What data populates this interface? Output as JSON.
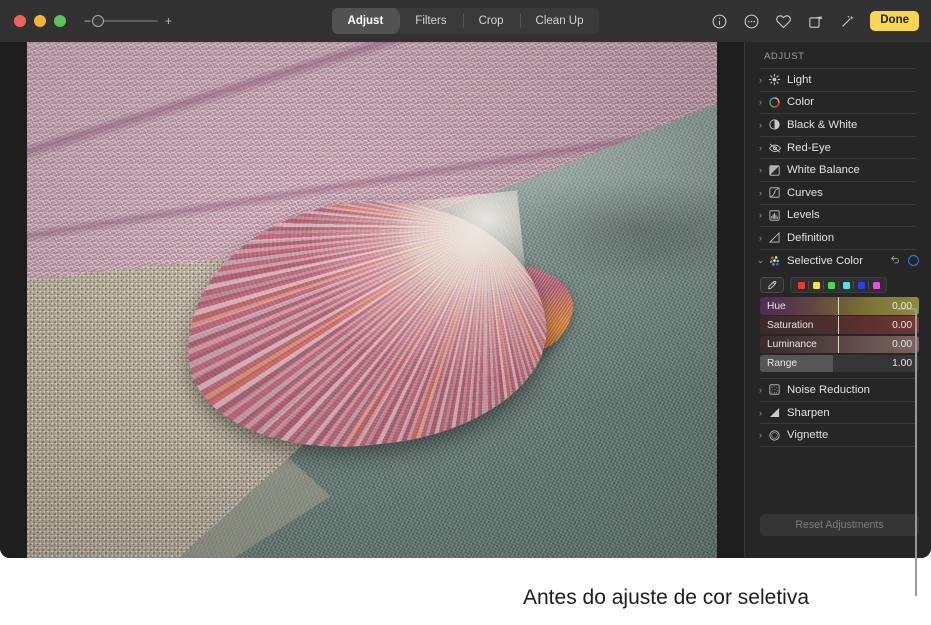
{
  "window": {
    "traffic_lights": [
      {
        "name": "close",
        "color": "#f2635a"
      },
      {
        "name": "minimize",
        "color": "#f5b53a"
      },
      {
        "name": "zoom",
        "color": "#5cc45a"
      }
    ]
  },
  "toolbar": {
    "zoom": {
      "minus": "−",
      "plus": "+",
      "level": 0
    },
    "tabs": [
      {
        "label": "Adjust",
        "active": true
      },
      {
        "label": "Filters",
        "active": false
      },
      {
        "label": "Crop",
        "active": false
      },
      {
        "label": "Clean Up",
        "active": false
      }
    ],
    "right_icons": [
      {
        "name": "info-icon",
        "glyph": "ⓘ"
      },
      {
        "name": "more-options-icon",
        "glyph": "…"
      },
      {
        "name": "favorite-heart-icon",
        "glyph": "♡"
      },
      {
        "name": "rotate-icon",
        "glyph": "↻"
      },
      {
        "name": "auto-enhance-wand-icon",
        "glyph": "✦"
      }
    ],
    "done_label": "Done",
    "done_color": "#f7d653"
  },
  "sidebar": {
    "title": "ADJUST",
    "items": [
      {
        "label": "Light",
        "icon": "sun-icon",
        "expanded": false
      },
      {
        "label": "Color",
        "icon": "color-wheel-icon",
        "expanded": false
      },
      {
        "label": "Black & White",
        "icon": "half-circle-icon",
        "expanded": false
      },
      {
        "label": "Red-Eye",
        "icon": "eye-slash-icon",
        "expanded": false
      },
      {
        "label": "White Balance",
        "icon": "white-balance-icon",
        "expanded": false
      },
      {
        "label": "Curves",
        "icon": "curves-icon",
        "expanded": false
      },
      {
        "label": "Levels",
        "icon": "levels-icon",
        "expanded": false
      },
      {
        "label": "Definition",
        "icon": "definition-icon",
        "expanded": false
      }
    ],
    "selective_color": {
      "label": "Selective Color",
      "icon": "selective-color-icon",
      "expanded": true,
      "revert_icon": "revert-arrow-icon",
      "toggle_icon": "enabled-circle-icon",
      "toggle_color": "#2f7bf0",
      "eyedropper_icon": "eyedropper-icon",
      "swatches": [
        {
          "name": "red",
          "color": "#ef3b2c"
        },
        {
          "name": "yellow",
          "color": "#f2e33c"
        },
        {
          "name": "green",
          "color": "#49dd4b"
        },
        {
          "name": "cyan",
          "color": "#4ae6e6"
        },
        {
          "name": "blue",
          "color": "#2b3ff0"
        },
        {
          "name": "magenta",
          "color": "#ef4aea"
        }
      ],
      "sliders": [
        {
          "label": "Hue",
          "value": "0.00",
          "position_pct": 49
        },
        {
          "label": "Saturation",
          "value": "0.00",
          "position_pct": 49
        },
        {
          "label": "Luminance",
          "value": "0.00",
          "position_pct": 49
        },
        {
          "label": "Range",
          "value": "1.00",
          "position_pct": 46
        }
      ]
    },
    "items_bottom": [
      {
        "label": "Noise Reduction",
        "icon": "noise-reduction-icon",
        "expanded": false
      },
      {
        "label": "Sharpen",
        "icon": "sharpen-icon",
        "expanded": false
      },
      {
        "label": "Vignette",
        "icon": "vignette-icon",
        "expanded": false
      }
    ],
    "reset_label": "Reset Adjustments"
  },
  "photo": {
    "alt": "Scallop shell on a teal towel with sand and pink sea fan coral"
  },
  "caption": "Antes do ajuste de cor seletiva"
}
